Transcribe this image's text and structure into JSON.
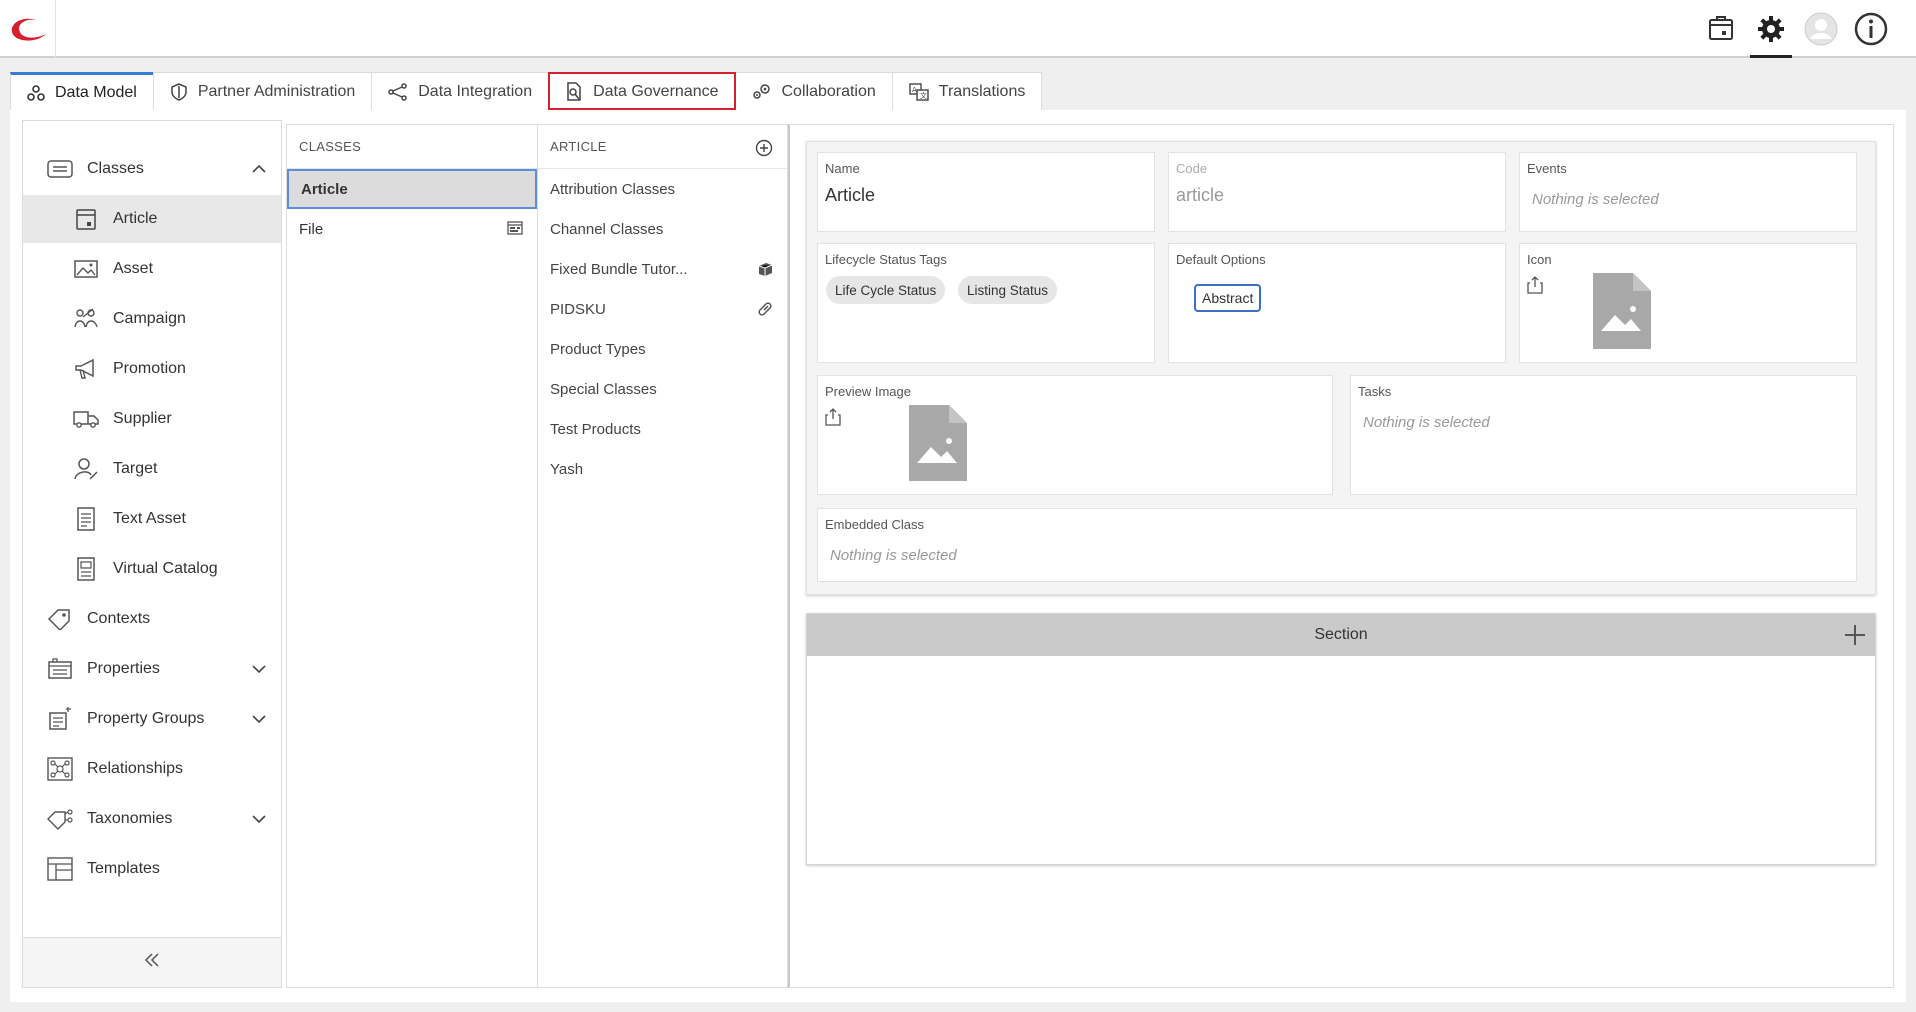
{
  "topbar": {
    "icons": [
      "logo-icon",
      "catalog-icon",
      "settings-icon",
      "user-avatar-icon",
      "info-icon"
    ],
    "accent": "#d6202e"
  },
  "tabs": [
    {
      "label": "Data Model",
      "icon": "data-model-icon"
    },
    {
      "label": "Partner Administration",
      "icon": "shield-icon"
    },
    {
      "label": "Data Integration",
      "icon": "share-nodes-icon"
    },
    {
      "label": "Data Governance",
      "icon": "document-search-icon"
    },
    {
      "label": "Collaboration",
      "icon": "gears-icon"
    },
    {
      "label": "Translations",
      "icon": "translate-icon"
    }
  ],
  "leftnav": {
    "classes": {
      "label": "Classes"
    },
    "sub_items": [
      {
        "label": "Article"
      },
      {
        "label": "Asset"
      },
      {
        "label": "Campaign"
      },
      {
        "label": "Promotion"
      },
      {
        "label": "Supplier"
      },
      {
        "label": "Target"
      },
      {
        "label": "Text Asset"
      },
      {
        "label": "Virtual Catalog"
      }
    ],
    "contexts": {
      "label": "Contexts"
    },
    "properties": {
      "label": "Properties"
    },
    "property_groups": {
      "label": "Property Groups"
    },
    "relationships": {
      "label": "Relationships"
    },
    "taxonomies": {
      "label": "Taxonomies"
    },
    "templates": {
      "label": "Templates"
    }
  },
  "classes_col": {
    "header": "CLASSES",
    "items": [
      {
        "label": "Article"
      },
      {
        "label": "File"
      }
    ]
  },
  "article_col": {
    "header": "ARTICLE",
    "items": [
      {
        "label": "Attribution Classes"
      },
      {
        "label": "Channel Classes"
      },
      {
        "label": "Fixed Bundle Tutor..."
      },
      {
        "label": "PIDSKU"
      },
      {
        "label": "Product Types"
      },
      {
        "label": "Special Classes"
      },
      {
        "label": "Test Products"
      },
      {
        "label": "Yash"
      }
    ]
  },
  "form": {
    "name": {
      "label": "Name",
      "value": "Article"
    },
    "code": {
      "label": "Code",
      "value": "article"
    },
    "events": {
      "label": "Events",
      "empty": "Nothing is selected"
    },
    "lifecycle": {
      "label": "Lifecycle Status Tags",
      "tags": [
        "Life Cycle Status",
        "Listing Status"
      ]
    },
    "default_options": {
      "label": "Default Options",
      "option": "Abstract"
    },
    "icon": {
      "label": "Icon"
    },
    "preview_image": {
      "label": "Preview Image"
    },
    "tasks": {
      "label": "Tasks",
      "empty": "Nothing is selected"
    },
    "embedded_class": {
      "label": "Embedded Class",
      "empty": "Nothing is selected"
    }
  },
  "section": {
    "title": "Section"
  }
}
